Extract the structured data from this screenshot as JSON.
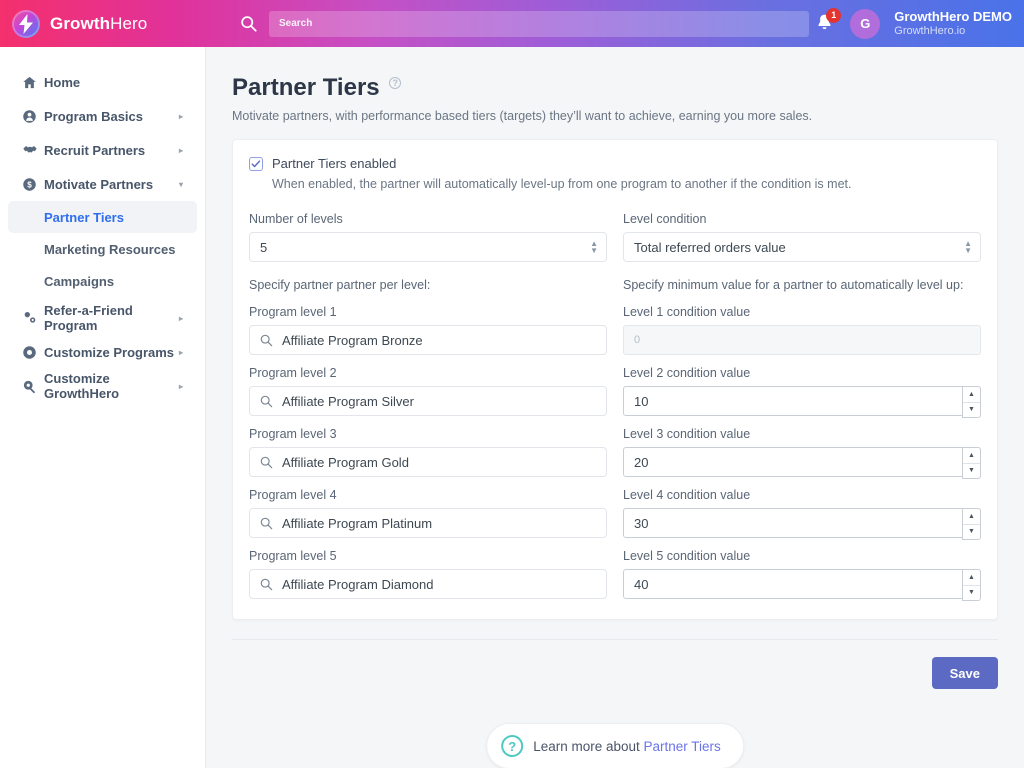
{
  "topbar": {
    "brand_bold": "Growth",
    "brand_light": "Hero",
    "logo_icon": "lightning-bolt-logo",
    "search_placeholder": "Search",
    "search_value": "",
    "search_icon": "search-icon",
    "bell_icon": "bell-icon",
    "bell_badge": "1",
    "avatar_initial": "G",
    "account_name": "GrowthHero DEMO",
    "account_domain": "GrowthHero.io"
  },
  "sidebar": {
    "items": [
      {
        "label": "Home",
        "icon": "home-icon",
        "caret": "",
        "active": false
      },
      {
        "label": "Program Basics",
        "icon": "person-circle-icon",
        "caret": "▸",
        "active": false
      },
      {
        "label": "Recruit Partners",
        "icon": "handshake-icon",
        "caret": "▸",
        "active": false
      },
      {
        "label": "Motivate Partners",
        "icon": "dollar-circle-icon",
        "caret": "▾",
        "active": false
      },
      {
        "label": "Refer-a-Friend Program",
        "icon": "referral-icon",
        "caret": "▸",
        "active": false
      },
      {
        "label": "Customize Programs",
        "icon": "customize-programs-icon",
        "caret": "▸",
        "active": false
      },
      {
        "label": "Customize GrowthHero",
        "icon": "wrench-gear-icon",
        "caret": "▸",
        "active": false
      }
    ],
    "subitems": [
      {
        "label": "Partner Tiers",
        "active": true
      },
      {
        "label": "Marketing Resources",
        "active": false
      },
      {
        "label": "Campaigns",
        "active": false
      }
    ]
  },
  "page": {
    "title": "Partner Tiers",
    "title_help_icon": "help-circle-icon",
    "description": "Motivate partners, with performance based tiers (targets) they’ll want to achieve, earning you more sales."
  },
  "form": {
    "enabled_checkbox_label": "Partner Tiers enabled",
    "enabled_checkbox_checked": true,
    "enabled_help": "When enabled, the partner will automatically level-up from one program to another if the condition is met.",
    "levels_label": "Number of levels",
    "levels_value": "5",
    "condition_label": "Level condition",
    "condition_value": "Total referred orders value",
    "left_hint": "Specify partner partner per level:",
    "right_hint": "Specify minimum value for a partner to automatically level up:",
    "program_levels": [
      {
        "label": "Program level 1",
        "value": "Affiliate Program Bronze",
        "icon": "search-icon"
      },
      {
        "label": "Program level 2",
        "value": "Affiliate Program Silver",
        "icon": "search-icon"
      },
      {
        "label": "Program level 3",
        "value": "Affiliate Program Gold",
        "icon": "search-icon"
      },
      {
        "label": "Program level 4",
        "value": "Affiliate Program Platinum",
        "icon": "search-icon"
      },
      {
        "label": "Program level 5",
        "value": "Affiliate Program Diamond",
        "icon": "search-icon"
      }
    ],
    "condition_values": [
      {
        "label": "Level 1 condition value",
        "value": "",
        "placeholder": "0",
        "disabled": true
      },
      {
        "label": "Level 2 condition value",
        "value": "10",
        "placeholder": "",
        "disabled": false
      },
      {
        "label": "Level 3 condition value",
        "value": "20",
        "placeholder": "",
        "disabled": false
      },
      {
        "label": "Level 4 condition value",
        "value": "30",
        "placeholder": "",
        "disabled": false
      },
      {
        "label": "Level 5 condition value",
        "value": "40",
        "placeholder": "",
        "disabled": false
      }
    ]
  },
  "footer": {
    "save_label": "Save",
    "learn_icon": "question-circle-icon",
    "learn_text": "Learn more about ",
    "learn_link": "Partner Tiers"
  },
  "colors": {
    "accent_pink": "#f4306d",
    "accent_blue": "#4a72e8",
    "save_button": "#5c6ac4",
    "active_nav": "#2f6fed",
    "badge_red": "#e3342f",
    "help_teal": "#4ec9c0"
  }
}
